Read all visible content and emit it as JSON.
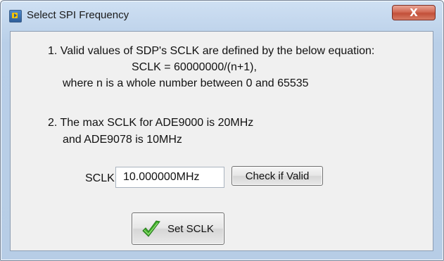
{
  "window": {
    "title": "Select SPI Frequency",
    "close_label": "X"
  },
  "instructions": {
    "item1_line1": "1. Valid values of SDP's SCLK are defined by the below equation:",
    "item1_line2": "SCLK = 60000000/(n+1),",
    "item1_line3": "where n is a whole number between 0 and 65535",
    "item2_line1": "2. The max SCLK for ADE9000 is 20MHz",
    "item2_line2": "and ADE9078 is 10MHz"
  },
  "sclk": {
    "label": "SCLK",
    "value": "10.000000MHz"
  },
  "buttons": {
    "check_label": "Check if Valid",
    "set_label": "Set SCLK"
  },
  "colors": {
    "title_bar": "#c4d7ee",
    "close_button": "#c94f39",
    "client_bg": "#f0f0f0",
    "checkmark": "#3fae2a"
  },
  "icons": {
    "app": "labview-app-icon",
    "close": "close-icon",
    "set_button": "green-checkmark-icon"
  }
}
